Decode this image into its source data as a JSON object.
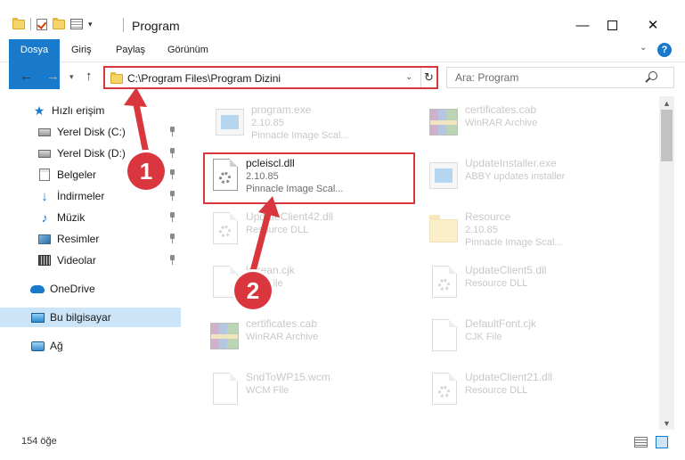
{
  "window": {
    "title": "Program",
    "minimize_glyph": "—",
    "close_glyph": "✕"
  },
  "ribbon": {
    "tabs": [
      "Dosya",
      "Giriş",
      "Paylaş",
      "Görünüm"
    ],
    "help_glyph": "?"
  },
  "address": {
    "path": "C:\\Program Files\\Program Dizini",
    "search_placeholder": "Ara: Program"
  },
  "sidebar": {
    "items": [
      {
        "label": "Hızlı erişim",
        "icon": "star-icon"
      },
      {
        "label": "Yerel Disk (C:)",
        "icon": "drive-icon"
      },
      {
        "label": "Yerel Disk (D:)",
        "icon": "drive-icon"
      },
      {
        "label": "Belgeler",
        "icon": "documents-icon"
      },
      {
        "label": "İndirmeler",
        "icon": "downloads-icon"
      },
      {
        "label": "Müzik",
        "icon": "music-icon"
      },
      {
        "label": "Resimler",
        "icon": "pictures-icon"
      },
      {
        "label": "Videolar",
        "icon": "videos-icon"
      },
      {
        "label": "OneDrive",
        "icon": "onedrive-icon"
      },
      {
        "label": "Bu bilgisayar",
        "icon": "computer-icon"
      },
      {
        "label": "Ağ",
        "icon": "network-icon"
      }
    ]
  },
  "files": [
    {
      "name": "program.exe",
      "line1": "2.10.85",
      "line2": "Pinnacle Image Scal...",
      "icon": "exe-icon"
    },
    {
      "name": "certificates.cab",
      "line1": "WinRAR Archive",
      "line2": "",
      "icon": "rar-icon"
    },
    {
      "name": "pcleiscl.dll",
      "line1": "2.10.85",
      "line2": "Pinnacle Image Scal...",
      "icon": "dll-icon"
    },
    {
      "name": "UpdateInstaller.exe",
      "line1": "ABBY updates installer",
      "line2": "",
      "icon": "exe-icon"
    },
    {
      "name": "UpdateClient42.dll",
      "line1": "Resource DLL",
      "line2": "",
      "icon": "dll-icon"
    },
    {
      "name": "Resource",
      "line1": "2.10.85",
      "line2": "Pinnacle Image Scal...",
      "icon": "folder-icon"
    },
    {
      "name": "korean.cjk",
      "line1": "CJK File",
      "line2": "",
      "icon": "file-icon"
    },
    {
      "name": "UpdateClient5.dll",
      "line1": "Resource DLL",
      "line2": "",
      "icon": "dll-icon"
    },
    {
      "name": "certificates.cab",
      "line1": "WinRAR Archive",
      "line2": "",
      "icon": "rar-icon"
    },
    {
      "name": "DefaultFont.cjk",
      "line1": "CJK File",
      "line2": "",
      "icon": "file-icon"
    },
    {
      "name": "SndToWP15.wcm",
      "line1": "WCM File",
      "line2": "",
      "icon": "file-icon"
    },
    {
      "name": "UpdateClient21.dll",
      "line1": "Resource DLL",
      "line2": "",
      "icon": "dll-icon"
    }
  ],
  "status": {
    "item_count": "154 öğe"
  },
  "callouts": [
    "1",
    "2"
  ],
  "colors": {
    "accent": "#1979ca",
    "highlight": "#d9363e",
    "selected": "#cce4f7"
  }
}
